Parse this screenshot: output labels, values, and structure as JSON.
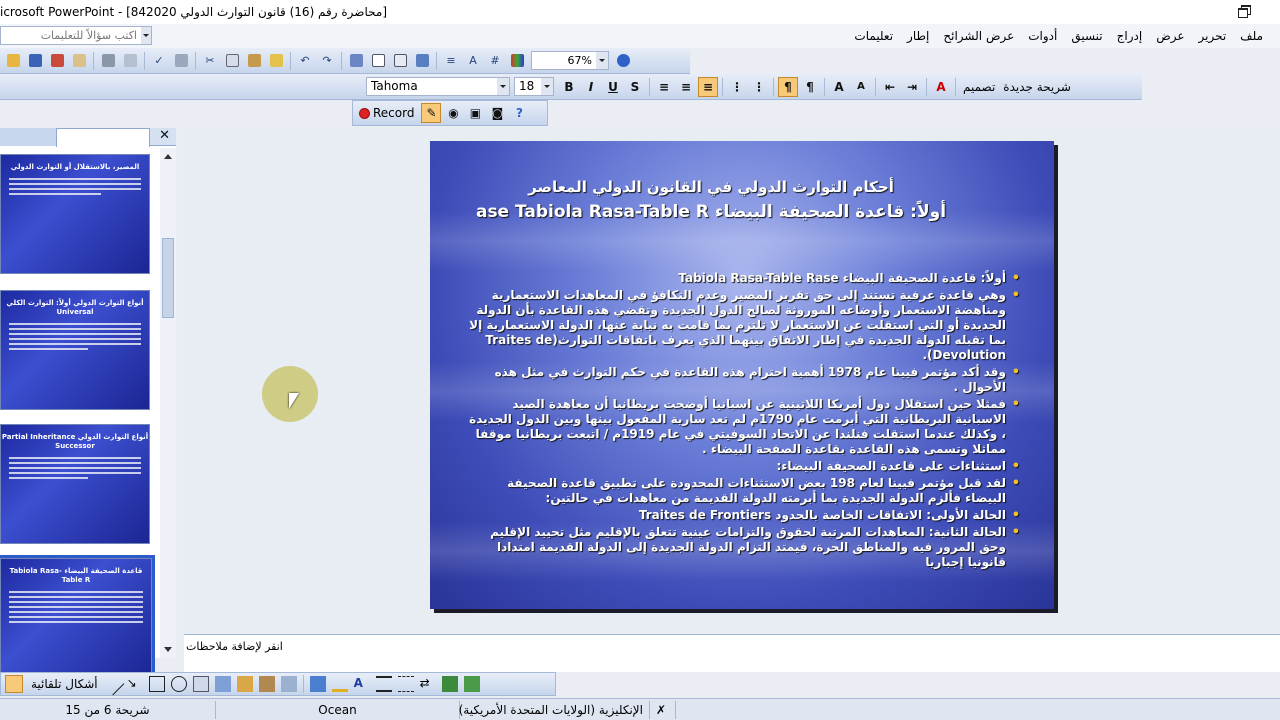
{
  "window": {
    "title": "icrosoft PowerPoint - [842020 محاضرة رقم (16) قانون التوارث الدولي]"
  },
  "menubar": {
    "ask_placeholder": "اكتب سؤالاً للتعليمات",
    "items": [
      "ملف",
      "تحرير",
      "عرض",
      "إدراج",
      "تنسيق",
      "أدوات",
      "عرض الشرائح",
      "إطار",
      "تعليمات"
    ]
  },
  "toolbar_standard": {
    "zoom": "67%"
  },
  "toolbar_formatting": {
    "font_name": "Tahoma",
    "font_size": "18",
    "bold": "B",
    "italic": "I",
    "underline": "U",
    "shadow": "S",
    "design_label": "تصميم",
    "new_slide_label": "شريحة جديدة"
  },
  "toolbar_record": {
    "record_label": "Record"
  },
  "slide": {
    "title_line1": "أحكام التوارث الدولي في القانون الدولي المعاصر",
    "title_line2": "أولاً: قاعدة الصحيفة البيضاء ase Tabiola Rasa-Table R",
    "bullets": [
      "أولاً: قاعدة الصحيفة البيضاء Tabiola Rasa-Table Rase",
      "وهي قاعدة عرفية تستند إلى حق تقرير المصير وعدم التكافؤ في المعاهدات الاستعمارية ومناهضة الاستعمار وأوضاعه الموروثة لصالح الدول الجديدة وتقضي هذه القاعدة بأن الدولة الجديدة أو التي استقلت عن الاستعمار لا تلتزم بما قامت به نيابة عنها، الدولة الاستعمارية إلا بما تقبله الدولة الجديدة في إطار الاتفاق بينهما الذي يعرف باتفاقات التوارث(Traites de Devolution).",
      "وقد أكد مؤتمر فيينا عام 1978 أهمية احترام هذه القاعدة في حكم التوارث في مثل هذه الأحوال .",
      "فمثلا حين استقلال دول أمريكا اللاتينية عن اسبانيا أوضحت بريطانيا أن معاهدة الصيد الاسبانية البريطانية التي أبرمت عام 1790م لم تعد سارية المفعول بينها وبين الدول الجديدة ، وكذلك عندما استقلت فنلندا عن الاتحاد السوفيتي في عام 1919م / اتبعت بريطانيا موقفا مماثلا وتسمى هذه القاعدة بقاعدة الصفحة البيضاء .",
      "استثناءات على قاعدة الصحيفة البيضاء:",
      "لقد قبل مؤتمر فيينا لعام 198 بعض الاستثناءات المحدودة على تطبيق قاعدة الصحيفة البيضاء فألزم الدولة الجديدة بما أبرمته الدولة القديمة من معاهدات في حالتين:",
      "الحالة الأولى: الاتفاقات الخاصة بالحدود Traites de Frontiers",
      "الحالة الثانية: المعاهدات المرتبة لحقوق والتزامات عينية تتعلق بالإقليم مثل تحييد الإقليم وحق المرور فيه والمناطق الحرة، فيمتد التزام الدولة الجديدة إلى الدولة القديمة امتدادا قانونيا إجباريا"
    ]
  },
  "thumbnails": [
    {
      "title": "المصير، بالاستقلال أو التوارث الدولي"
    },
    {
      "title": "أنواع التوارث الدولي أولاً: التوارث الكلي Universal"
    },
    {
      "title": "أنواع التوارث الدولي Partial Inheritance Successor"
    },
    {
      "title": "قاعدة الصحيفة البيضاء Tabiola Rasa-Table R"
    }
  ],
  "notes": {
    "placeholder": "انقر لإضافة ملاحظات"
  },
  "drawing_toolbar": {
    "autoshapes_label": "أشكال تلقائية"
  },
  "statusbar": {
    "slide_pos": "شريحة 6 من 15",
    "design": "Ocean",
    "language": "الإنكليزية (الولايات المتحدة الأمريكية)"
  }
}
